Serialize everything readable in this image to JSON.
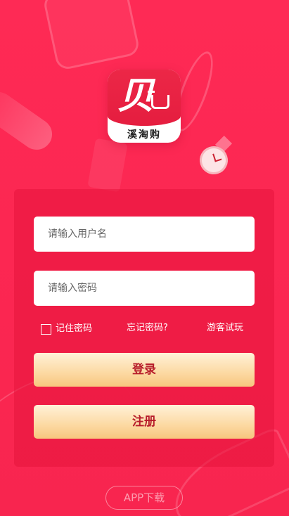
{
  "logo": {
    "char": "贝勺",
    "name": "溪淘购"
  },
  "form": {
    "username_placeholder": "请输入用户名",
    "password_placeholder": "请输入密码",
    "remember_label": "记住密码",
    "forgot_label": "忘记密码?",
    "guest_label": "游客试玩"
  },
  "buttons": {
    "login": "登录",
    "register": "注册"
  },
  "footer": {
    "app_download": "APP下载"
  }
}
